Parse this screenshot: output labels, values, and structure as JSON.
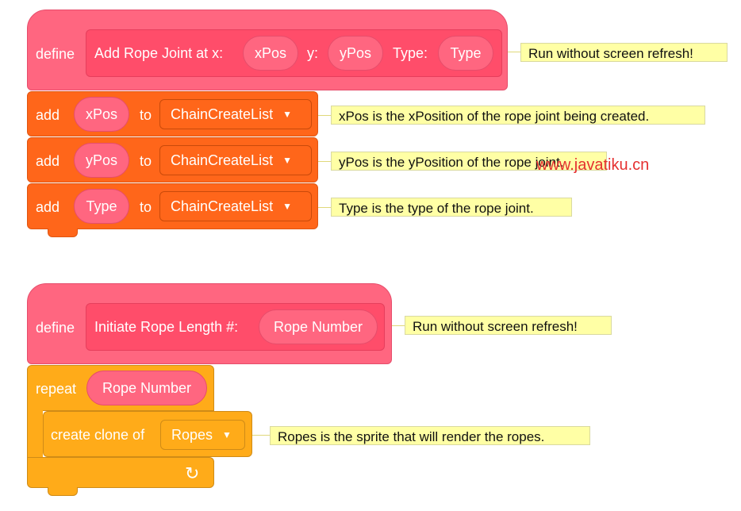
{
  "colors": {
    "custom_block": "#ff6680",
    "list_block": "#ff661a",
    "control_block": "#ffab19",
    "comment_bg": "#ffffa5",
    "watermark": "#e53030"
  },
  "script1": {
    "define_label": "define",
    "proc_name": "Add Rope Joint at x:",
    "arg_x": "xPos",
    "label_y": "y:",
    "arg_y": "yPos",
    "label_type": "Type:",
    "arg_type": "Type",
    "define_comment": "Run without screen refresh!",
    "rows": [
      {
        "op": "add",
        "value": "xPos",
        "to": "to",
        "list": "ChainCreateList",
        "comment": "xPos is the xPosition of the rope joint being created."
      },
      {
        "op": "add",
        "value": "yPos",
        "to": "to",
        "list": "ChainCreateList",
        "comment": "yPos is the yPosition of the rope joint."
      },
      {
        "op": "add",
        "value": "Type",
        "to": "to",
        "list": "ChainCreateList",
        "comment": "Type is the type of the rope joint."
      }
    ]
  },
  "script2": {
    "define_label": "define",
    "proc_name": "Initiate Rope Length #:",
    "arg": "Rope Number",
    "define_comment": "Run without screen refresh!",
    "repeat_label": "repeat",
    "repeat_arg": "Rope Number",
    "clone_label": "create clone of",
    "clone_target": "Ropes",
    "clone_comment": "Ropes is the sprite that will render the ropes.",
    "loop_icon": "loop-arrow-icon"
  },
  "watermark": "www.javatiku.cn"
}
